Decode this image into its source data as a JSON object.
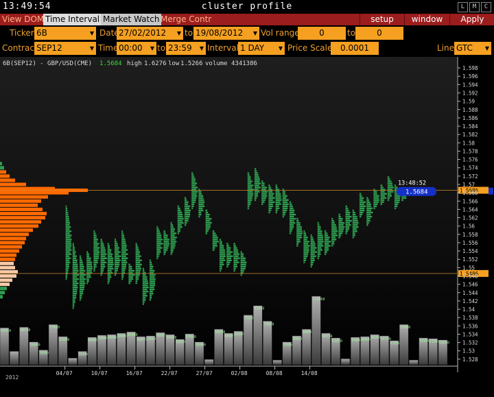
{
  "window": {
    "clock": "13:49:54",
    "title": "cluster profile",
    "buttons": [
      "L",
      "M",
      "C"
    ]
  },
  "menu": {
    "items": [
      "View DOM",
      "Time Interval",
      "Market Watch",
      "Merge Contr"
    ],
    "selected": "Time Interval",
    "right": [
      "setup",
      "window",
      "Apply"
    ]
  },
  "form": {
    "ticker_label": "Ticker",
    "ticker": "6B",
    "date_label": "Date",
    "date_from": "27/02/2012",
    "to1": "to",
    "date_to": "19/08/2012",
    "vol_label": "Vol range",
    "vol_from": "0",
    "to2": "to",
    "vol_to": "0",
    "contract_label": "Contract",
    "contract": "SEP12",
    "time_label": "Time",
    "time_from": "00:00",
    "to3": "to",
    "time_to": "23:59",
    "interval_label": "Interval",
    "interval": "1 DAY",
    "scale_label": "Price Scale",
    "scale": "0.0001",
    "line_label": "Line",
    "line": "GTC"
  },
  "colors": {
    "profile_green": "#2e9e50",
    "profile_orange": "#ff6a00",
    "volume_gray": "#9a9a9a",
    "level_line": "#d08a30",
    "current_tag": "#1530c8",
    "level_tag": "#f5a020"
  },
  "chart_data": {
    "type": "bar",
    "title": "6B(SEP12) - GBP/USD(CME)",
    "header": {
      "last": "1.5684",
      "high_label": "high",
      "high": "1.6276",
      "low_label": "low",
      "low": "1.5266",
      "volume_label": "volume",
      "volume": "4341386"
    },
    "ylim": [
      1.526,
      1.599
    ],
    "y_ticks": [
      "1.598",
      "1.596",
      "1.594",
      "1.592",
      "1.59",
      "1.588",
      "1.586",
      "1.584",
      "1.582",
      "1.58",
      "1.578",
      "1.576",
      "1.574",
      "1.572",
      "1.57",
      "1.568",
      "1.566",
      "1.564",
      "1.562",
      "1.56",
      "1.558",
      "1.556",
      "1.554",
      "1.552",
      "1.55",
      "1.548",
      "1.546",
      "1.544",
      "1.542",
      "1.54",
      "1.538",
      "1.536",
      "1.534",
      "1.532",
      "1.53",
      "1.528"
    ],
    "x_ticks": [
      "04/07",
      "10/07",
      "16/07",
      "22/07",
      "27/07",
      "02/08",
      "08/08",
      "14/08"
    ],
    "x_tick_days": [
      3,
      8,
      13,
      18,
      23,
      28,
      33,
      38
    ],
    "year_label": "2012",
    "current_price": 1.5684,
    "current_time": "13:48:52",
    "current_label": "1.5684",
    "levels": [
      1.5686,
      1.5486
    ],
    "level_labels": [
      "1.5686",
      "1.5486"
    ],
    "candles": [
      {
        "d": 0,
        "lo": 1.547,
        "hi": 1.565
      },
      {
        "d": 1,
        "lo": 1.54,
        "hi": 1.556
      },
      {
        "d": 2,
        "lo": 1.542,
        "hi": 1.553
      },
      {
        "d": 3,
        "lo": 1.546,
        "hi": 1.554
      },
      {
        "d": 4,
        "lo": 1.549,
        "hi": 1.559
      },
      {
        "d": 5,
        "lo": 1.548,
        "hi": 1.557
      },
      {
        "d": 6,
        "lo": 1.546,
        "hi": 1.556
      },
      {
        "d": 7,
        "lo": 1.548,
        "hi": 1.557
      },
      {
        "d": 8,
        "lo": 1.547,
        "hi": 1.559
      },
      {
        "d": 9,
        "lo": 1.546,
        "hi": 1.551
      },
      {
        "d": 10,
        "lo": 1.546,
        "hi": 1.556
      },
      {
        "d": 11,
        "lo": 1.541,
        "hi": 1.55
      },
      {
        "d": 12,
        "lo": 1.542,
        "hi": 1.552
      },
      {
        "d": 13,
        "lo": 1.552,
        "hi": 1.56
      },
      {
        "d": 14,
        "lo": 1.553,
        "hi": 1.559
      },
      {
        "d": 15,
        "lo": 1.553,
        "hi": 1.561
      },
      {
        "d": 16,
        "lo": 1.558,
        "hi": 1.565
      },
      {
        "d": 17,
        "lo": 1.56,
        "hi": 1.567
      },
      {
        "d": 18,
        "lo": 1.564,
        "hi": 1.573
      },
      {
        "d": 19,
        "lo": 1.562,
        "hi": 1.569
      },
      {
        "d": 20,
        "lo": 1.558,
        "hi": 1.564
      },
      {
        "d": 21,
        "lo": 1.554,
        "hi": 1.559
      },
      {
        "d": 22,
        "lo": 1.549,
        "hi": 1.557
      },
      {
        "d": 23,
        "lo": 1.55,
        "hi": 1.556
      },
      {
        "d": 24,
        "lo": 1.549,
        "hi": 1.556
      },
      {
        "d": 25,
        "lo": 1.548,
        "hi": 1.554
      },
      {
        "d": 26,
        "lo": 1.564,
        "hi": 1.573
      },
      {
        "d": 27,
        "lo": 1.566,
        "hi": 1.574
      },
      {
        "d": 28,
        "lo": 1.565,
        "hi": 1.571
      },
      {
        "d": 29,
        "lo": 1.563,
        "hi": 1.57
      },
      {
        "d": 30,
        "lo": 1.563,
        "hi": 1.57
      },
      {
        "d": 31,
        "lo": 1.562,
        "hi": 1.569
      },
      {
        "d": 32,
        "lo": 1.558,
        "hi": 1.566
      },
      {
        "d": 33,
        "lo": 1.555,
        "hi": 1.562
      },
      {
        "d": 34,
        "lo": 1.551,
        "hi": 1.559
      },
      {
        "d": 35,
        "lo": 1.55,
        "hi": 1.558
      },
      {
        "d": 36,
        "lo": 1.552,
        "hi": 1.561
      },
      {
        "d": 37,
        "lo": 1.553,
        "hi": 1.559
      },
      {
        "d": 38,
        "lo": 1.555,
        "hi": 1.562
      },
      {
        "d": 39,
        "lo": 1.557,
        "hi": 1.563
      },
      {
        "d": 40,
        "lo": 1.558,
        "hi": 1.565
      },
      {
        "d": 41,
        "lo": 1.557,
        "hi": 1.564
      },
      {
        "d": 42,
        "lo": 1.562,
        "hi": 1.568
      },
      {
        "d": 43,
        "lo": 1.56,
        "hi": 1.567
      },
      {
        "d": 44,
        "lo": 1.564,
        "hi": 1.569
      },
      {
        "d": 45,
        "lo": 1.565,
        "hi": 1.57
      },
      {
        "d": 46,
        "lo": 1.566,
        "hi": 1.572
      },
      {
        "d": 47,
        "lo": 1.564,
        "hi": 1.57
      },
      {
        "d": 48,
        "lo": 1.566,
        "hi": 1.569
      }
    ],
    "volumes": [
      {
        "d": 0,
        "v": 2750,
        "label": "60014"
      },
      {
        "d": 1,
        "v": 1000,
        "label": ""
      },
      {
        "d": 2,
        "v": 2800,
        "label": "66540"
      },
      {
        "d": 3,
        "v": 1700,
        "label": "56040"
      },
      {
        "d": 4,
        "v": 1100,
        "label": "30000"
      },
      {
        "d": 5,
        "v": 3000,
        "label": "77010"
      },
      {
        "d": 6,
        "v": 2100,
        "label": "50000"
      },
      {
        "d": 7,
        "v": 500,
        "label": ""
      },
      {
        "d": 8,
        "v": 1000,
        "label": "30000"
      },
      {
        "d": 9,
        "v": 2050,
        "label": "60000"
      },
      {
        "d": 10,
        "v": 2200,
        "label": "54060"
      },
      {
        "d": 11,
        "v": 2250,
        "label": "60000"
      },
      {
        "d": 12,
        "v": 2350,
        "label": "60000"
      },
      {
        "d": 13,
        "v": 2450,
        "label": "65000"
      },
      {
        "d": 14,
        "v": 2100,
        "label": "60070"
      },
      {
        "d": 15,
        "v": 2150,
        "label": "54020"
      },
      {
        "d": 16,
        "v": 2400,
        "label": "60001"
      },
      {
        "d": 17,
        "v": 2250,
        "label": "56050"
      },
      {
        "d": 18,
        "v": 1900,
        "label": "50000"
      },
      {
        "d": 19,
        "v": 2300,
        "label": "57000"
      },
      {
        "d": 20,
        "v": 1700,
        "label": "45000"
      },
      {
        "d": 21,
        "v": 400,
        "label": ""
      },
      {
        "d": 22,
        "v": 2650,
        "label": "68000"
      },
      {
        "d": 23,
        "v": 2350,
        "label": "60007"
      },
      {
        "d": 24,
        "v": 2500,
        "label": "62000"
      },
      {
        "d": 25,
        "v": 3700,
        "label": "75020"
      },
      {
        "d": 26,
        "v": 4400,
        "label": "95000"
      },
      {
        "d": 27,
        "v": 3250,
        "label": "79000"
      },
      {
        "d": 28,
        "v": 350,
        "label": ""
      },
      {
        "d": 29,
        "v": 1700,
        "label": "50000"
      },
      {
        "d": 30,
        "v": 2150,
        "label": "60020"
      },
      {
        "d": 31,
        "v": 2650,
        "label": "68000"
      },
      {
        "d": 32,
        "v": 5100,
        "label": "113000"
      },
      {
        "d": 33,
        "v": 2350,
        "label": "60134"
      },
      {
        "d": 34,
        "v": 2000,
        "label": "51000"
      },
      {
        "d": 35,
        "v": 450,
        "label": ""
      },
      {
        "d": 36,
        "v": 2050,
        "label": "54000"
      },
      {
        "d": 37,
        "v": 2100,
        "label": "60000"
      },
      {
        "d": 38,
        "v": 2250,
        "label": "60200"
      },
      {
        "d": 39,
        "v": 2150,
        "label": "54700"
      },
      {
        "d": 40,
        "v": 1800,
        "label": "47000"
      },
      {
        "d": 41,
        "v": 3000,
        "label": "78000"
      },
      {
        "d": 42,
        "v": 350,
        "label": ""
      },
      {
        "d": 43,
        "v": 2000,
        "label": "55000"
      },
      {
        "d": 44,
        "v": 1950,
        "label": "51000"
      },
      {
        "d": 45,
        "v": 1850,
        "label": "50000"
      }
    ],
    "left_profile": [
      {
        "p": 1.575,
        "w": 3,
        "c": "green"
      },
      {
        "p": 1.574,
        "w": 6,
        "c": "green"
      },
      {
        "p": 1.573,
        "w": 9,
        "c": "orange"
      },
      {
        "p": 1.572,
        "w": 14,
        "c": "orange"
      },
      {
        "p": 1.571,
        "w": 22,
        "c": "orange"
      },
      {
        "p": 1.57,
        "w": 38,
        "c": "orange"
      },
      {
        "p": 1.569,
        "w": 80,
        "c": "orange"
      },
      {
        "p": 1.5686,
        "w": 128,
        "c": "orange"
      },
      {
        "p": 1.568,
        "w": 100,
        "c": "orange"
      },
      {
        "p": 1.567,
        "w": 70,
        "c": "orange"
      },
      {
        "p": 1.566,
        "w": 60,
        "c": "orange"
      },
      {
        "p": 1.565,
        "w": 55,
        "c": "orange"
      },
      {
        "p": 1.564,
        "w": 62,
        "c": "orange"
      },
      {
        "p": 1.563,
        "w": 68,
        "c": "orange"
      },
      {
        "p": 1.562,
        "w": 66,
        "c": "orange"
      },
      {
        "p": 1.561,
        "w": 60,
        "c": "orange"
      },
      {
        "p": 1.56,
        "w": 56,
        "c": "orange"
      },
      {
        "p": 1.559,
        "w": 48,
        "c": "orange"
      },
      {
        "p": 1.558,
        "w": 42,
        "c": "orange"
      },
      {
        "p": 1.557,
        "w": 38,
        "c": "orange"
      },
      {
        "p": 1.556,
        "w": 36,
        "c": "orange"
      },
      {
        "p": 1.555,
        "w": 32,
        "c": "orange"
      },
      {
        "p": 1.554,
        "w": 28,
        "c": "orange"
      },
      {
        "p": 1.553,
        "w": 24,
        "c": "orange"
      },
      {
        "p": 1.552,
        "w": 22,
        "c": "orange"
      },
      {
        "p": 1.551,
        "w": 20,
        "c": "peach"
      },
      {
        "p": 1.55,
        "w": 22,
        "c": "peach"
      },
      {
        "p": 1.549,
        "w": 26,
        "c": "peach"
      },
      {
        "p": 1.548,
        "w": 24,
        "c": "peach"
      },
      {
        "p": 1.547,
        "w": 18,
        "c": "peach"
      },
      {
        "p": 1.546,
        "w": 14,
        "c": "peach"
      },
      {
        "p": 1.545,
        "w": 10,
        "c": "green"
      },
      {
        "p": 1.544,
        "w": 7,
        "c": "green"
      },
      {
        "p": 1.543,
        "w": 4,
        "c": "green"
      }
    ]
  }
}
